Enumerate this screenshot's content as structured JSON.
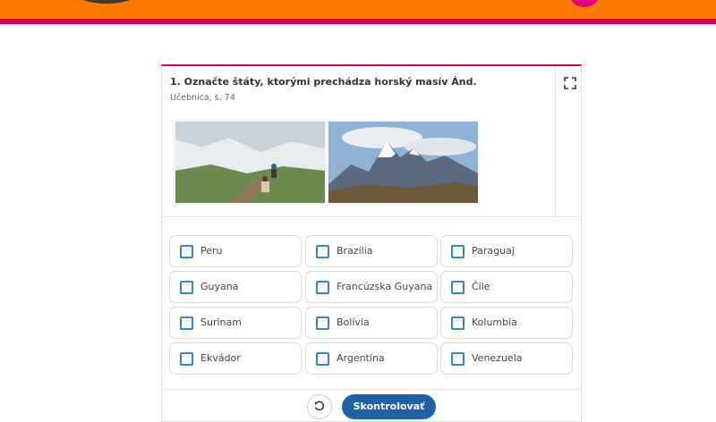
{
  "question": {
    "title": "1. Označte štáty, ktorými prechádza horský masív Ánd.",
    "reference": "Učebnica, s. 74"
  },
  "images": [
    {
      "icon": "mountain-trail-photo",
      "alt": ""
    },
    {
      "icon": "snowy-peaks-photo",
      "alt": ""
    }
  ],
  "options": [
    {
      "label": "Peru"
    },
    {
      "label": "Brazília"
    },
    {
      "label": "Paraguaj"
    },
    {
      "label": "Guyana"
    },
    {
      "label": "Francúzska Guyana"
    },
    {
      "label": "Čile"
    },
    {
      "label": "Surinam"
    },
    {
      "label": "Bolívia"
    },
    {
      "label": "Kolumbia"
    },
    {
      "label": "Ekvádor"
    },
    {
      "label": "Argentína"
    },
    {
      "label": "Venezuela"
    }
  ],
  "actions": {
    "reset_icon": "reset-icon",
    "check_label": "Skontrolovať"
  },
  "colors": {
    "banner": "#ff7a00",
    "accent": "#d6004f",
    "checkbox": "#3b7fd0",
    "button": "#1f62a8"
  }
}
